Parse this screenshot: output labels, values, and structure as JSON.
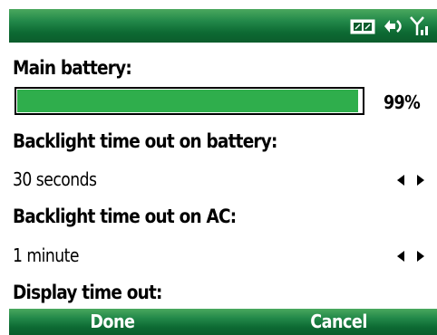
{
  "status_icons": [
    "battery-icon",
    "connection-icon",
    "signal-icon"
  ],
  "battery": {
    "label": "Main battery:",
    "level": 0.99,
    "percent_text": "99%"
  },
  "backlight_battery": {
    "label": "Backlight time out on battery:",
    "value": "30 seconds"
  },
  "backlight_ac": {
    "label": "Backlight time out on AC:",
    "value": "1 minute"
  },
  "display_timeout": {
    "label": "Display time out:"
  },
  "softkeys": {
    "left": "Done",
    "right": "Cancel"
  },
  "colors": {
    "bar_green": "#0d6a33",
    "battery_fill": "#2fae4c"
  }
}
